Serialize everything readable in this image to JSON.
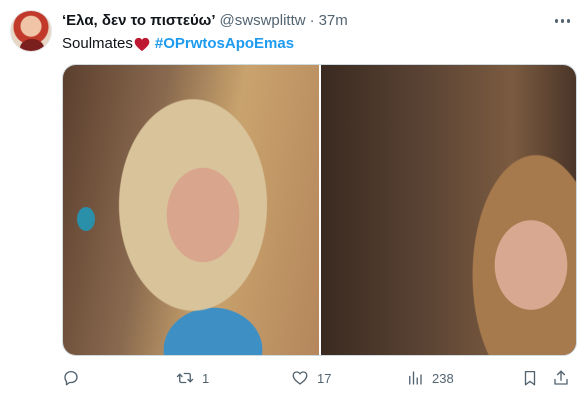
{
  "tweet": {
    "author": {
      "display_name": "‘Ελα, δεν το πιστεύω’",
      "handle": "@swswplittw",
      "separator": "·",
      "time": "37m"
    },
    "text": "Soulmates",
    "emoji": "red-heart",
    "hashtag": "#OPrwtosApoEmas",
    "media": [
      {
        "kind": "photo",
        "subject": "blonde-woman-close-up"
      },
      {
        "kind": "photo",
        "subject": "smiling-woman-close-up"
      }
    ],
    "actions": {
      "reply": {
        "icon": "reply-icon",
        "count": ""
      },
      "retweet": {
        "icon": "retweet-icon",
        "count": "1"
      },
      "like": {
        "icon": "heart-icon",
        "count": "17"
      },
      "views": {
        "icon": "views-icon",
        "count": "238"
      },
      "bookmark": {
        "icon": "bookmark-icon"
      },
      "share": {
        "icon": "share-icon"
      }
    }
  },
  "colors": {
    "text_primary": "#0f1419",
    "text_secondary": "#536471",
    "link": "#1d9bf0",
    "heart_emoji": "#be1931"
  }
}
